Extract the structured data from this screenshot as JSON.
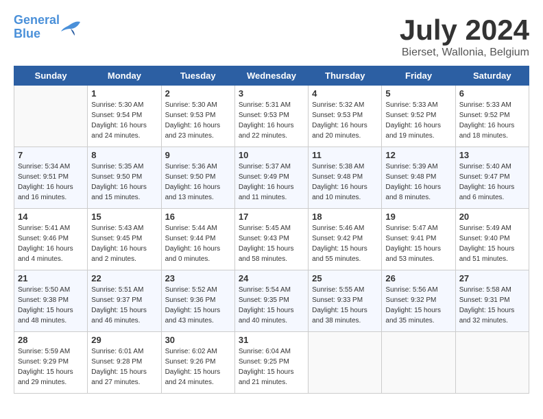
{
  "header": {
    "logo_line1": "General",
    "logo_line2": "Blue",
    "month_title": "July 2024",
    "location": "Bierset, Wallonia, Belgium"
  },
  "days_of_week": [
    "Sunday",
    "Monday",
    "Tuesday",
    "Wednesday",
    "Thursday",
    "Friday",
    "Saturday"
  ],
  "weeks": [
    [
      {
        "day": "",
        "sunrise": "",
        "sunset": "",
        "daylight": "",
        "empty": true
      },
      {
        "day": "1",
        "sunrise": "Sunrise: 5:30 AM",
        "sunset": "Sunset: 9:54 PM",
        "daylight": "Daylight: 16 hours and 24 minutes."
      },
      {
        "day": "2",
        "sunrise": "Sunrise: 5:30 AM",
        "sunset": "Sunset: 9:53 PM",
        "daylight": "Daylight: 16 hours and 23 minutes."
      },
      {
        "day": "3",
        "sunrise": "Sunrise: 5:31 AM",
        "sunset": "Sunset: 9:53 PM",
        "daylight": "Daylight: 16 hours and 22 minutes."
      },
      {
        "day": "4",
        "sunrise": "Sunrise: 5:32 AM",
        "sunset": "Sunset: 9:53 PM",
        "daylight": "Daylight: 16 hours and 20 minutes."
      },
      {
        "day": "5",
        "sunrise": "Sunrise: 5:33 AM",
        "sunset": "Sunset: 9:52 PM",
        "daylight": "Daylight: 16 hours and 19 minutes."
      },
      {
        "day": "6",
        "sunrise": "Sunrise: 5:33 AM",
        "sunset": "Sunset: 9:52 PM",
        "daylight": "Daylight: 16 hours and 18 minutes."
      }
    ],
    [
      {
        "day": "7",
        "sunrise": "Sunrise: 5:34 AM",
        "sunset": "Sunset: 9:51 PM",
        "daylight": "Daylight: 16 hours and 16 minutes."
      },
      {
        "day": "8",
        "sunrise": "Sunrise: 5:35 AM",
        "sunset": "Sunset: 9:50 PM",
        "daylight": "Daylight: 16 hours and 15 minutes."
      },
      {
        "day": "9",
        "sunrise": "Sunrise: 5:36 AM",
        "sunset": "Sunset: 9:50 PM",
        "daylight": "Daylight: 16 hours and 13 minutes."
      },
      {
        "day": "10",
        "sunrise": "Sunrise: 5:37 AM",
        "sunset": "Sunset: 9:49 PM",
        "daylight": "Daylight: 16 hours and 11 minutes."
      },
      {
        "day": "11",
        "sunrise": "Sunrise: 5:38 AM",
        "sunset": "Sunset: 9:48 PM",
        "daylight": "Daylight: 16 hours and 10 minutes."
      },
      {
        "day": "12",
        "sunrise": "Sunrise: 5:39 AM",
        "sunset": "Sunset: 9:48 PM",
        "daylight": "Daylight: 16 hours and 8 minutes."
      },
      {
        "day": "13",
        "sunrise": "Sunrise: 5:40 AM",
        "sunset": "Sunset: 9:47 PM",
        "daylight": "Daylight: 16 hours and 6 minutes."
      }
    ],
    [
      {
        "day": "14",
        "sunrise": "Sunrise: 5:41 AM",
        "sunset": "Sunset: 9:46 PM",
        "daylight": "Daylight: 16 hours and 4 minutes."
      },
      {
        "day": "15",
        "sunrise": "Sunrise: 5:43 AM",
        "sunset": "Sunset: 9:45 PM",
        "daylight": "Daylight: 16 hours and 2 minutes."
      },
      {
        "day": "16",
        "sunrise": "Sunrise: 5:44 AM",
        "sunset": "Sunset: 9:44 PM",
        "daylight": "Daylight: 16 hours and 0 minutes."
      },
      {
        "day": "17",
        "sunrise": "Sunrise: 5:45 AM",
        "sunset": "Sunset: 9:43 PM",
        "daylight": "Daylight: 15 hours and 58 minutes."
      },
      {
        "day": "18",
        "sunrise": "Sunrise: 5:46 AM",
        "sunset": "Sunset: 9:42 PM",
        "daylight": "Daylight: 15 hours and 55 minutes."
      },
      {
        "day": "19",
        "sunrise": "Sunrise: 5:47 AM",
        "sunset": "Sunset: 9:41 PM",
        "daylight": "Daylight: 15 hours and 53 minutes."
      },
      {
        "day": "20",
        "sunrise": "Sunrise: 5:49 AM",
        "sunset": "Sunset: 9:40 PM",
        "daylight": "Daylight: 15 hours and 51 minutes."
      }
    ],
    [
      {
        "day": "21",
        "sunrise": "Sunrise: 5:50 AM",
        "sunset": "Sunset: 9:38 PM",
        "daylight": "Daylight: 15 hours and 48 minutes."
      },
      {
        "day": "22",
        "sunrise": "Sunrise: 5:51 AM",
        "sunset": "Sunset: 9:37 PM",
        "daylight": "Daylight: 15 hours and 46 minutes."
      },
      {
        "day": "23",
        "sunrise": "Sunrise: 5:52 AM",
        "sunset": "Sunset: 9:36 PM",
        "daylight": "Daylight: 15 hours and 43 minutes."
      },
      {
        "day": "24",
        "sunrise": "Sunrise: 5:54 AM",
        "sunset": "Sunset: 9:35 PM",
        "daylight": "Daylight: 15 hours and 40 minutes."
      },
      {
        "day": "25",
        "sunrise": "Sunrise: 5:55 AM",
        "sunset": "Sunset: 9:33 PM",
        "daylight": "Daylight: 15 hours and 38 minutes."
      },
      {
        "day": "26",
        "sunrise": "Sunrise: 5:56 AM",
        "sunset": "Sunset: 9:32 PM",
        "daylight": "Daylight: 15 hours and 35 minutes."
      },
      {
        "day": "27",
        "sunrise": "Sunrise: 5:58 AM",
        "sunset": "Sunset: 9:31 PM",
        "daylight": "Daylight: 15 hours and 32 minutes."
      }
    ],
    [
      {
        "day": "28",
        "sunrise": "Sunrise: 5:59 AM",
        "sunset": "Sunset: 9:29 PM",
        "daylight": "Daylight: 15 hours and 29 minutes."
      },
      {
        "day": "29",
        "sunrise": "Sunrise: 6:01 AM",
        "sunset": "Sunset: 9:28 PM",
        "daylight": "Daylight: 15 hours and 27 minutes."
      },
      {
        "day": "30",
        "sunrise": "Sunrise: 6:02 AM",
        "sunset": "Sunset: 9:26 PM",
        "daylight": "Daylight: 15 hours and 24 minutes."
      },
      {
        "day": "31",
        "sunrise": "Sunrise: 6:04 AM",
        "sunset": "Sunset: 9:25 PM",
        "daylight": "Daylight: 15 hours and 21 minutes."
      },
      {
        "day": "",
        "sunrise": "",
        "sunset": "",
        "daylight": "",
        "empty": true
      },
      {
        "day": "",
        "sunrise": "",
        "sunset": "",
        "daylight": "",
        "empty": true
      },
      {
        "day": "",
        "sunrise": "",
        "sunset": "",
        "daylight": "",
        "empty": true
      }
    ]
  ]
}
